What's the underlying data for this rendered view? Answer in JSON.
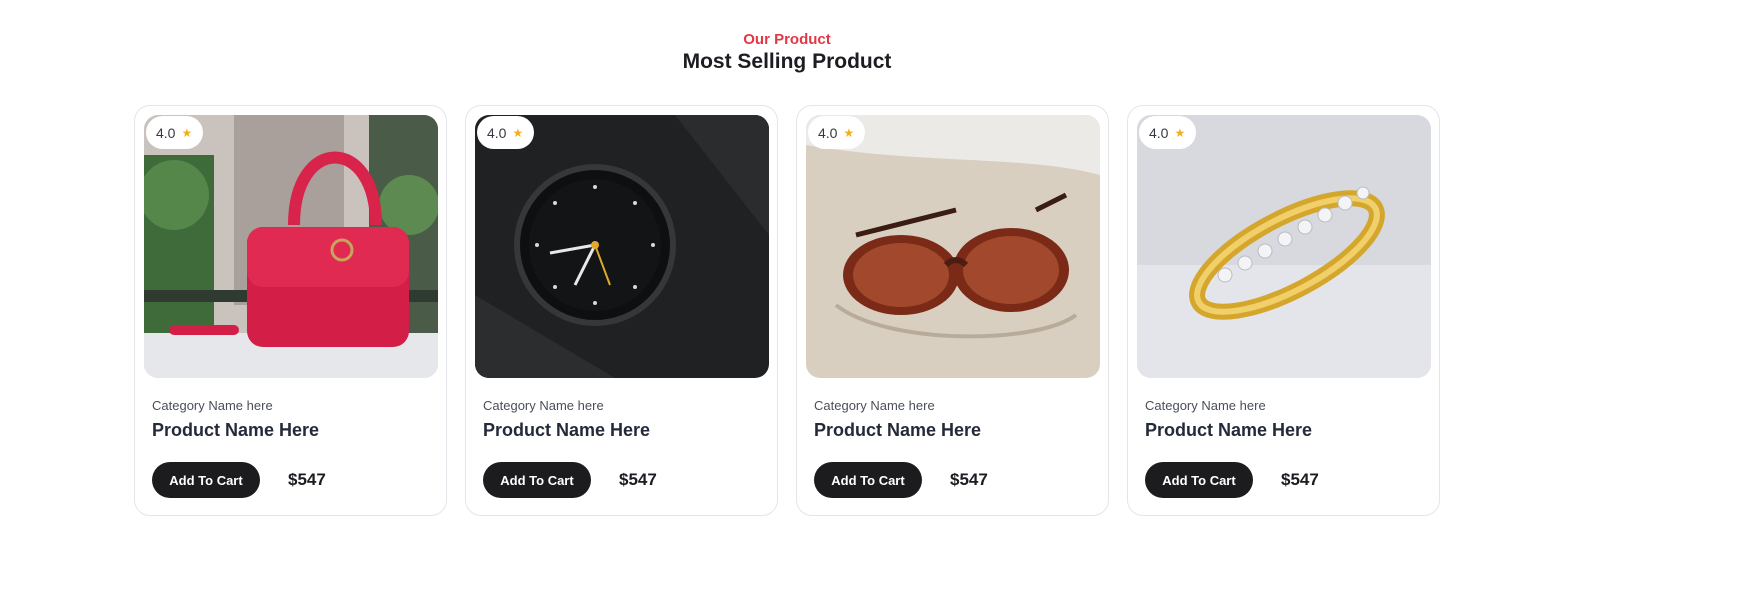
{
  "section": {
    "eyebrow": "Our Product",
    "title": "Most Selling Product",
    "accent_color": "#e23744"
  },
  "products": [
    {
      "rating": "4.0",
      "image_icon": "handbag-image",
      "category": "Category Name here",
      "name": "Product Name Here",
      "cart_label": "Add To Cart",
      "price": "$547"
    },
    {
      "rating": "4.0",
      "image_icon": "watch-image",
      "category": "Category Name here",
      "name": "Product Name Here",
      "cart_label": "Add To Cart",
      "price": "$547"
    },
    {
      "rating": "4.0",
      "image_icon": "sunglasses-image",
      "category": "Category Name here",
      "name": "Product Name Here",
      "cart_label": "Add To Cart",
      "price": "$547"
    },
    {
      "rating": "4.0",
      "image_icon": "ring-image",
      "category": "Category Name here",
      "name": "Product Name Here",
      "cart_label": "Add To Cart",
      "price": "$547"
    }
  ],
  "colors": {
    "button_bg": "#1c1c1e",
    "star": "#f2b01e"
  }
}
